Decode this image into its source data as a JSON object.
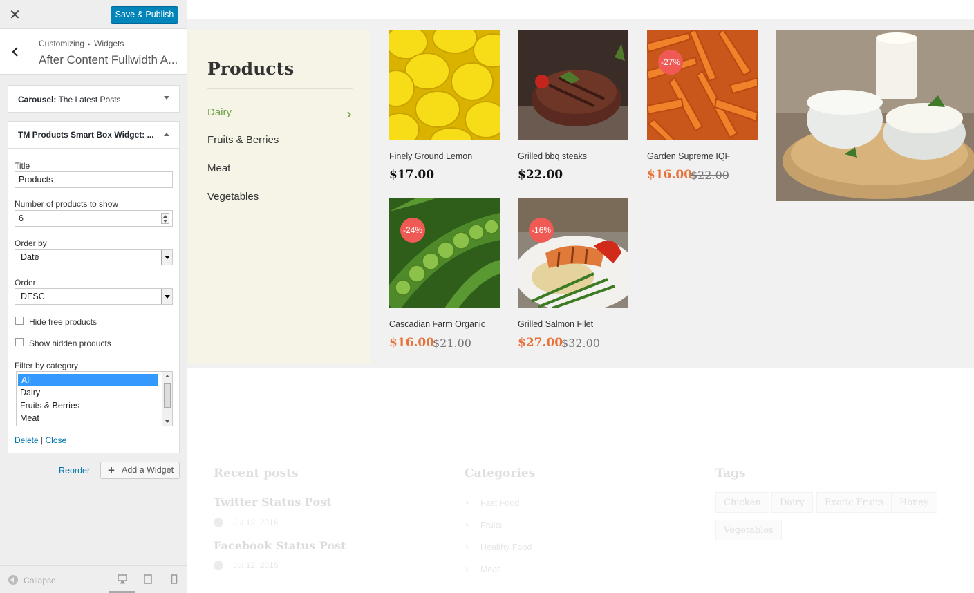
{
  "topbar": {
    "close_glyph": "✕",
    "publish_label": "Save & Publish"
  },
  "section": {
    "crumb_parent": "Customizing",
    "crumb_sep": "▸",
    "crumb_child": "Widgets",
    "title": "After Content Fullwidth A..."
  },
  "widget1": {
    "title_bold": "Carousel:",
    "title_rest": " The Latest Posts"
  },
  "widget2": {
    "title": "TM Products Smart Box Widget: ...",
    "title_label": "Title",
    "title_value": "Products",
    "count_label": "Number of products to show",
    "count_value": "6",
    "orderby_label": "Order by",
    "orderby_value": "Date",
    "order_label": "Order",
    "order_value": "DESC",
    "hide_free_label": "Hide free products",
    "show_hidden_label": "Show hidden products",
    "filter_label": "Filter by category",
    "categories": [
      "All",
      "Dairy",
      "Fruits & Berries",
      "Meat"
    ],
    "delete_label": "Delete",
    "actions_sep": "|",
    "close_label": "Close"
  },
  "sidebar_actions": {
    "reorder_label": "Reorder",
    "add_widget_label": "Add a Widget"
  },
  "footer": {
    "collapse_label": "Collapse"
  },
  "preview": {
    "menu": {
      "title": "Products",
      "items": [
        "Dairy",
        "Fruits & Berries",
        "Meat",
        "Vegetables"
      ]
    },
    "products": [
      {
        "name": "Finely Ground Lemon",
        "price": "$17.00",
        "old_price": "",
        "badge": ""
      },
      {
        "name": "Grilled bbq steaks",
        "price": "$22.00",
        "old_price": "",
        "badge": ""
      },
      {
        "name": "Garden Supreme IQF",
        "price": "$16.00",
        "old_price": "$22.00",
        "badge": "-27%"
      },
      {
        "name": "Cascadian Farm Organic",
        "price": "$16.00",
        "old_price": "$21.00",
        "badge": "-24%"
      },
      {
        "name": "Grilled Salmon Filet",
        "price": "$27.00",
        "old_price": "$32.00",
        "badge": "-16%"
      }
    ],
    "faded": {
      "recent_heading": "Recent posts",
      "posts": [
        {
          "title": "Twitter Status Post",
          "date": "Jul 12, 2016"
        },
        {
          "title": "Facebook Status Post",
          "date": "Jul 12, 2016"
        }
      ],
      "categories_heading": "Categories",
      "categories": [
        "Fast Food",
        "Fruits",
        "Healthy Food",
        "Meat"
      ],
      "tags_heading": "Tags",
      "tags": [
        "Chicken",
        "Dairy",
        "Exotic Fruits",
        "Honey",
        "Vegetables"
      ]
    }
  },
  "colors": {
    "accent": "#0085ba",
    "sale": "#e7723a",
    "badge": "#f05a55",
    "menu_active": "#6da345"
  }
}
